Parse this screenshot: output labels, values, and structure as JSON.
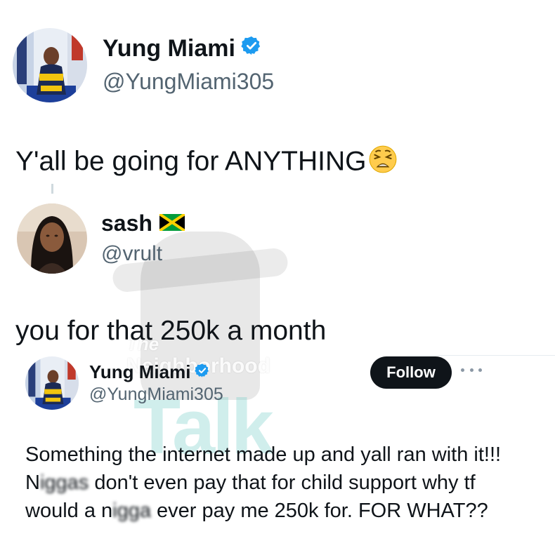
{
  "main_tweet": {
    "author": {
      "display_name": "Yung Miami",
      "handle": "@YungMiami305",
      "verified": true,
      "verified_color": "#1d9bf0"
    },
    "text": "Y'all be going for ANYTHING",
    "emoji": "weary-face"
  },
  "quoted_tweet": {
    "author": {
      "display_name": "sash",
      "handle": "@vrult",
      "flag": "jamaica-flag"
    },
    "text": "you for that 250k a month"
  },
  "embedded_tweet": {
    "author": {
      "display_name": "Yung Miami",
      "handle": "@YungMiami305",
      "verified": true
    },
    "follow_label": "Follow",
    "more_icon": "more-horizontal-icon",
    "text_parts": {
      "p1": "Something the internet made up and yall ran with it!!! N",
      "censored1": "iggas",
      "p2": " don't even pay that for child support why tf would a n",
      "censored2": "igga",
      "p3": " ever pay me 250k for. FOR WHAT??"
    }
  },
  "colors": {
    "text_primary": "#0f1419",
    "text_secondary": "#536471",
    "button_bg": "#0f1419",
    "verified": "#1d9bf0"
  }
}
